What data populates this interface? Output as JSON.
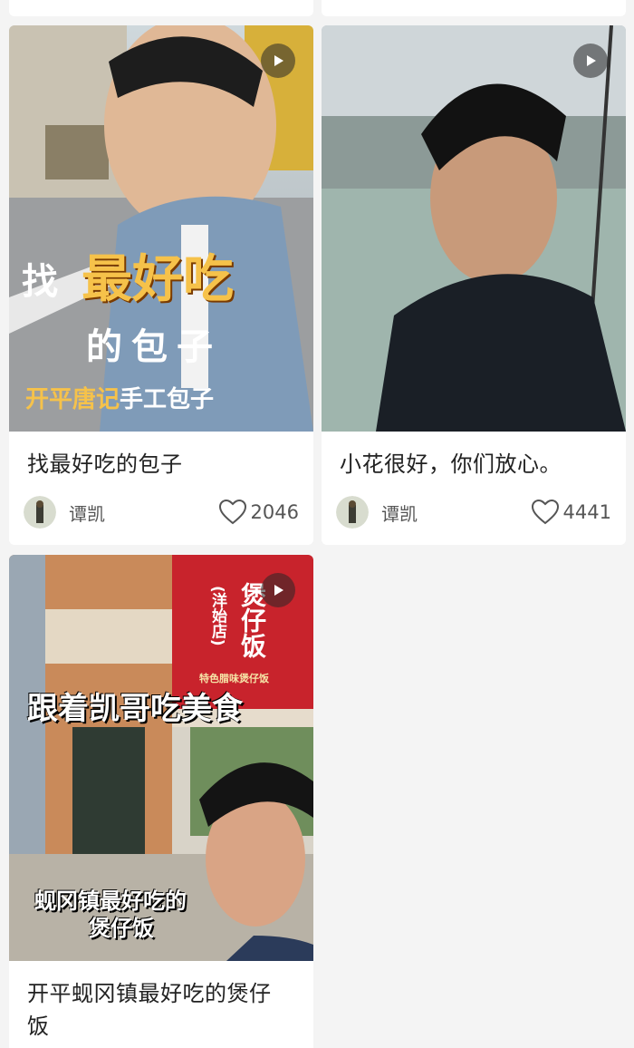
{
  "cards": [
    {
      "title": "找最好吃的包子",
      "author": "谭凯",
      "likes": "2046",
      "overlay": {
        "line1_prefix": "找",
        "line1_main": "最好吃",
        "line2": "的包子",
        "line3_a": "开平唐记",
        "line3_b": "手工包子"
      }
    },
    {
      "title": "小花很好，你们放心。",
      "author": "谭凯",
      "likes": "4441"
    },
    {
      "title": "开平蚬冈镇最好吃的煲仔饭",
      "overlay": {
        "headline": "跟着凯哥吃美食",
        "sign_line1": "煲仔饭",
        "sign_line2": "(洋始店)",
        "sign_line3": "特色腊味煲仔饭",
        "caption_line1": "蚬冈镇最好吃的",
        "caption_line2": "煲仔饭"
      }
    }
  ],
  "icons": {
    "play": "play-icon",
    "heart": "heart-outline-icon",
    "avatar": "avatar-icon"
  },
  "colors": {
    "card_bg": "#ffffff",
    "page_bg": "#f4f4f4",
    "overlay_yellow": "#f6c24a",
    "sign_red": "#c8232c"
  }
}
